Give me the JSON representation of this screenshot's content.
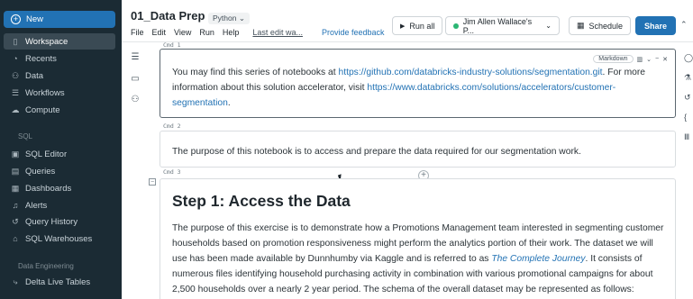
{
  "sidebar": {
    "new_label": "New",
    "items": [
      {
        "label": "Workspace",
        "icon": "workspace-icon",
        "glyph": "▯"
      },
      {
        "label": "Recents",
        "icon": "clock-icon",
        "glyph": "◔"
      },
      {
        "label": "Data",
        "icon": "data-icon",
        "glyph": "⚇"
      },
      {
        "label": "Workflows",
        "icon": "workflows-icon",
        "glyph": "☰"
      },
      {
        "label": "Compute",
        "icon": "cloud-icon",
        "glyph": "☁"
      }
    ],
    "sql_section": "SQL",
    "sql_items": [
      {
        "label": "SQL Editor",
        "icon": "sql-editor-icon",
        "glyph": "▣"
      },
      {
        "label": "Queries",
        "icon": "queries-icon",
        "glyph": "▤"
      },
      {
        "label": "Dashboards",
        "icon": "dashboards-icon",
        "glyph": "▦"
      },
      {
        "label": "Alerts",
        "icon": "bell-icon",
        "glyph": "♫"
      },
      {
        "label": "Query History",
        "icon": "history-icon",
        "glyph": "↺"
      },
      {
        "label": "SQL Warehouses",
        "icon": "warehouse-icon",
        "glyph": "⌂"
      }
    ],
    "de_section": "Data Engineering",
    "de_items": [
      {
        "label": "Delta Live Tables",
        "icon": "delta-icon",
        "glyph": "⤷"
      }
    ]
  },
  "header": {
    "title": "01_Data Prep",
    "language": "Python ⌄",
    "menu": [
      "File",
      "Edit",
      "View",
      "Run",
      "Help"
    ],
    "last_edit": "Last edit wa...",
    "feedback": "Provide feedback",
    "run_all": "Run all",
    "cluster": "Jim Allen Wallace's P...",
    "schedule": "Schedule",
    "share": "Share"
  },
  "cells": {
    "cmd1": "Cmd 1",
    "cmd2": "Cmd 2",
    "cmd3": "Cmd 3",
    "markdown_label": "Markdown",
    "cell1_line1_pre": "You may find this series of notebooks at ",
    "cell1_link1": "https://github.com/databricks-industry-solutions/segmentation.git",
    "cell1_line1_post": ". For more",
    "cell1_line2_pre": "information about this solution accelerator, visit ",
    "cell1_link2a": "https://www.databricks.com/solutions/accelerators/customer-",
    "cell1_link2b": "segmentation",
    "cell1_line3_post": ".",
    "cell2_text": "The purpose of this notebook is to access and prepare the data required for our segmentation work.",
    "cell3_heading": "Step 1: Access the Data",
    "cell3_p1": "The purpose of this exercise is to demonstrate how a Promotions Management team interested in segmenting customer",
    "cell3_p2": "households based on promotion responsiveness might perform the analytics portion of their work. The dataset we will",
    "cell3_p3_pre": "use has been made available by Dunnhumby via Kaggle and is referred to as ",
    "cell3_p3_em": "The Complete Journey",
    "cell3_p3_post": ". It consists of",
    "cell3_p4": "numerous files identifying household purchasing activity in combination with various promotional campaigns for about",
    "cell3_p5": "2,500 households over a nearly 2 year period. The schema of the overall dataset may be represented as follows:"
  },
  "colors": {
    "sidebar_bg": "#1b2b34",
    "accent": "#2272b4",
    "status_green": "#2bb673"
  }
}
